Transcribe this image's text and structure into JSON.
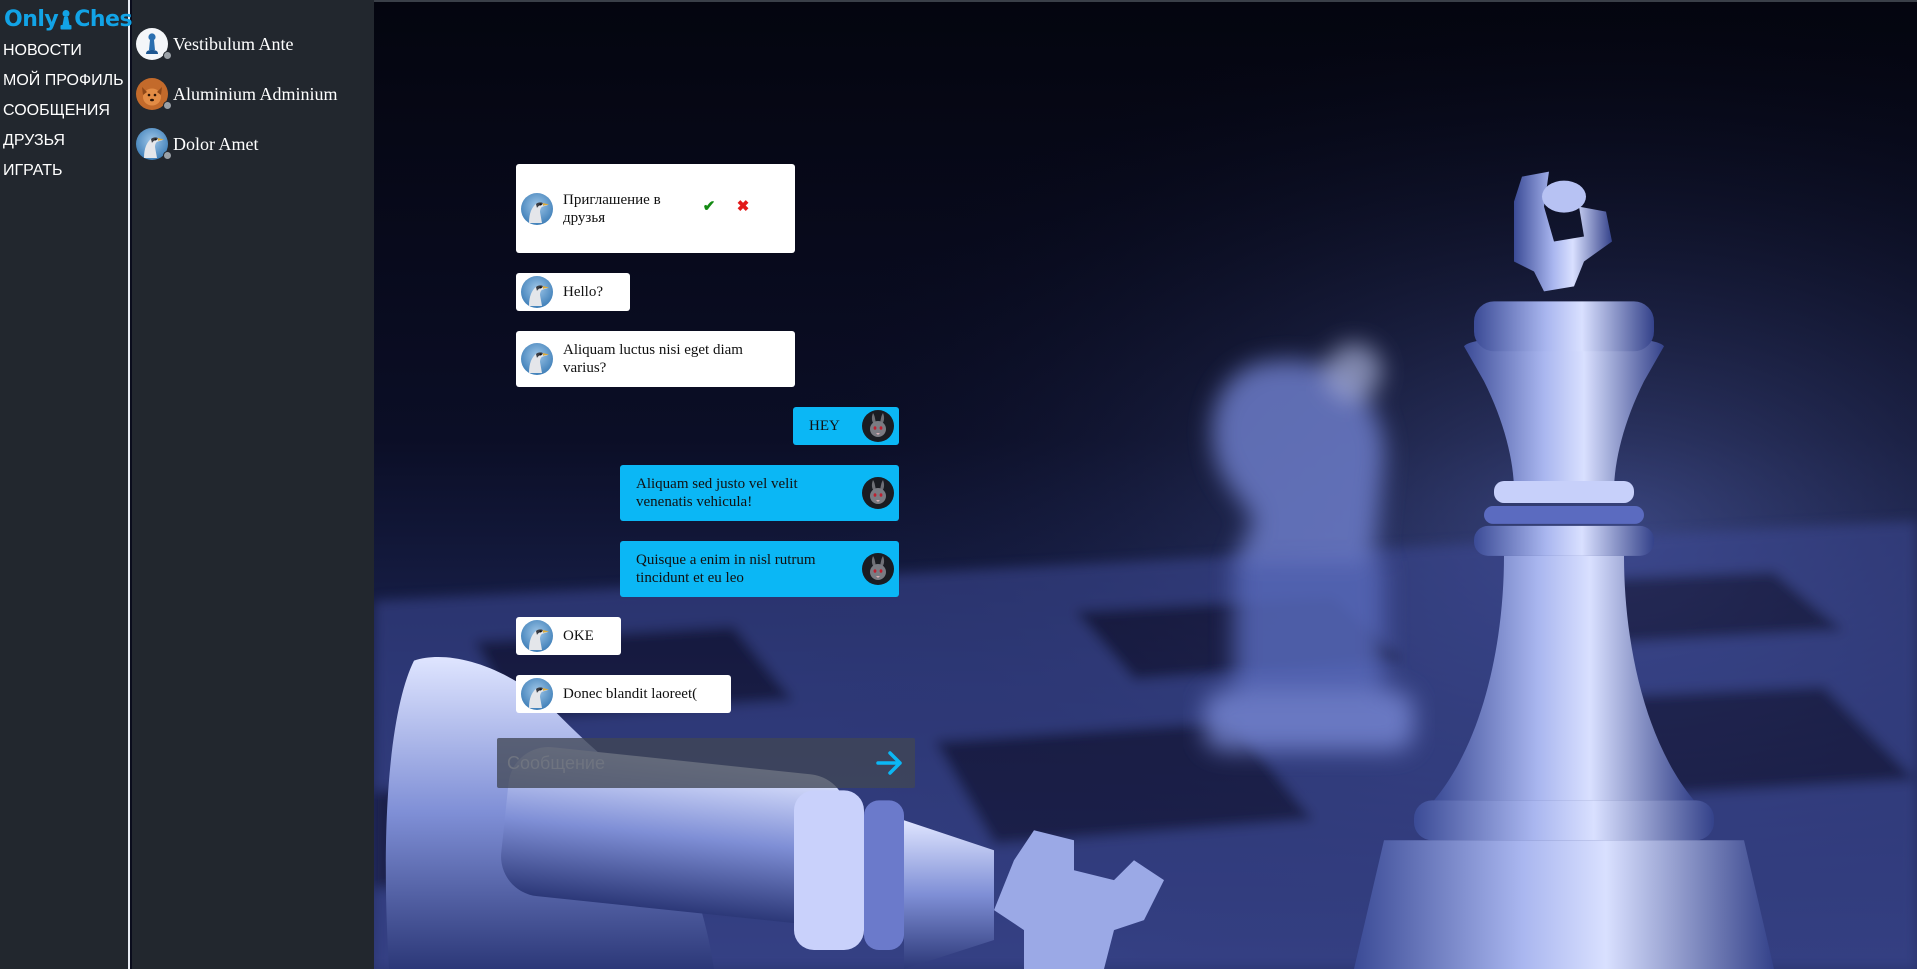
{
  "app": {
    "logo_left": "Only",
    "logo_right": "Chess",
    "brand_color": "#12a3e6"
  },
  "nav": {
    "items": [
      {
        "label": "НОВОСТИ"
      },
      {
        "label": "МОЙ ПРОФИЛЬ"
      },
      {
        "label": "СООБЩЕНИЯ"
      },
      {
        "label": "ДРУЗЬЯ"
      },
      {
        "label": "ИГРАТЬ"
      }
    ]
  },
  "friends": [
    {
      "name": "Vestibulum Ante",
      "avatar": "pawn-avatar",
      "status": "offline"
    },
    {
      "name": "Aluminium Adminium",
      "avatar": "dog-avatar",
      "status": "offline"
    },
    {
      "name": "Dolor Amet",
      "avatar": "bird-avatar",
      "status": "offline"
    }
  ],
  "chat": {
    "invite": {
      "text": "Приглашение в друзья",
      "accept_icon": "check-icon",
      "decline_icon": "cross-icon"
    },
    "messages": [
      {
        "direction": "in",
        "text": "Hello?"
      },
      {
        "direction": "in",
        "text": "Aliquam luctus nisi eget diam varius?"
      },
      {
        "direction": "out",
        "text": "HEY"
      },
      {
        "direction": "out",
        "text": "Aliquam sed justo vel velit venenatis vehicula!"
      },
      {
        "direction": "out",
        "text": "Quisque a enim in nisl rutrum tincidunt et eu leo"
      },
      {
        "direction": "in",
        "text": "OKE"
      },
      {
        "direction": "in",
        "text": "Donec blandit laoreet("
      }
    ],
    "composer": {
      "placeholder": "Сообщение",
      "value": "",
      "send_icon": "arrow-right-icon"
    },
    "incoming_bubble_color": "#ffffff",
    "outgoing_bubble_color": "#0bb7f5"
  }
}
